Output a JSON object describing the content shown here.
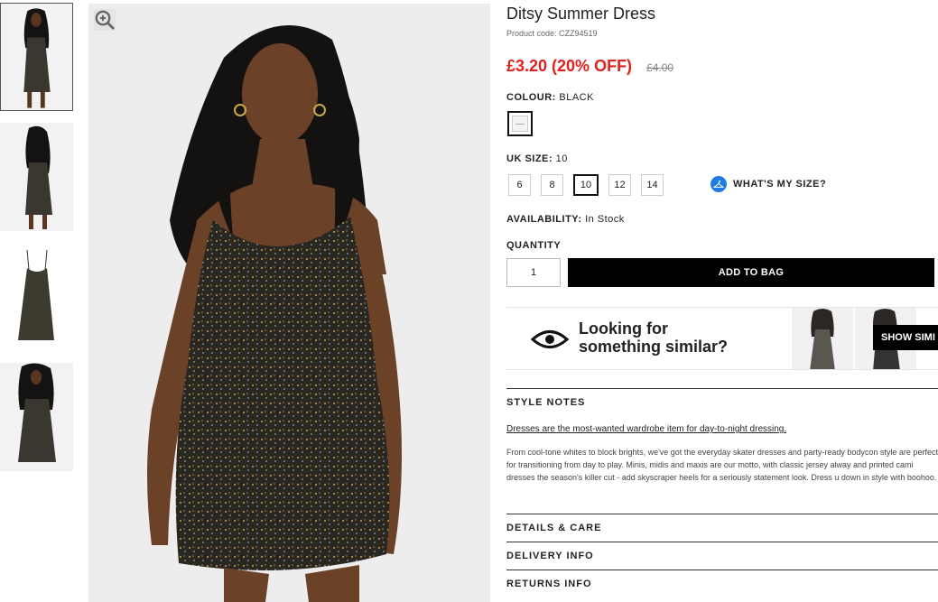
{
  "product": {
    "title": "Ditsy Summer Dress",
    "code": "Product code: CZZ94519",
    "price_now": "£3.20 (20% OFF)",
    "price_was": "£4.00"
  },
  "colour": {
    "label": "COLOUR:",
    "value": "BLACK"
  },
  "size": {
    "label": "UK SIZE:",
    "value": "10",
    "options": [
      "6",
      "8",
      "10",
      "12",
      "14"
    ],
    "selected": "10",
    "guide_label": "WHAT'S MY SIZE?"
  },
  "availability": {
    "label": "AVAILABILITY:",
    "value": "In Stock"
  },
  "quantity": {
    "label": "QUANTITY",
    "value": "1"
  },
  "add_to_bag_label": "ADD TO BAG",
  "similar": {
    "line1": "Looking for",
    "line2": "something similar?",
    "button_label": "SHOW SIMI"
  },
  "style_notes": {
    "heading": "STYLE NOTES",
    "lead": "Dresses are the most-wanted wardrobe item for day-to-night dressing.",
    "body": "From cool-tone whites to block brights, we've got the everyday skater dresses and party-ready bodycon style are perfect for transitioning from day to play. Minis, midis and maxis are our motto, with classic jersey alway and printed cami dresses the season's killer cut - add skyscraper heels for a seriously statement look. Dress u down in style with boohoo."
  },
  "sections": {
    "details": "DETAILS & CARE",
    "delivery": "DELIVERY INFO",
    "returns": "RETURNS INFO"
  },
  "colors": {
    "sale": "#e0211c",
    "accent_blue": "#1f7ce0",
    "button_black": "#000000"
  }
}
